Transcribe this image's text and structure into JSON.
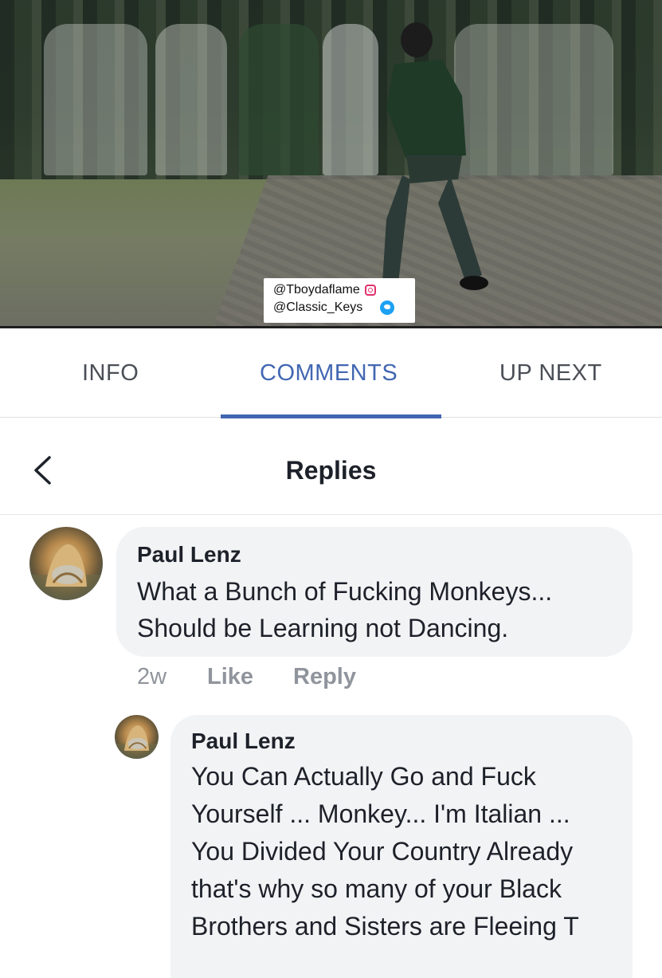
{
  "video": {
    "watermark_instagram": "@Tboydaflame",
    "watermark_twitter": "@Classic_Keys"
  },
  "tabs": [
    {
      "label": "INFO",
      "active": false
    },
    {
      "label": "COMMENTS",
      "active": true
    },
    {
      "label": "UP NEXT",
      "active": false
    }
  ],
  "replies": {
    "title": "Replies"
  },
  "comment": {
    "author": "Paul Lenz",
    "text": "What a Bunch of Fucking Monkeys... Should be Learning not Dancing.",
    "time": "2w",
    "like_label": "Like",
    "reply_label": "Reply"
  },
  "reply": {
    "author": "Paul Lenz",
    "text": "You Can Actually Go and Fuck Yourself ... Monkey... I'm Italian ... You Divided Your Country Already that's why so many of your Black Brothers and Sisters are Fleeing T"
  },
  "colors": {
    "accent": "#4267b2",
    "tab_text": "#4b4f56",
    "bubble_bg": "#f2f3f5",
    "meta_text": "#90949c"
  }
}
